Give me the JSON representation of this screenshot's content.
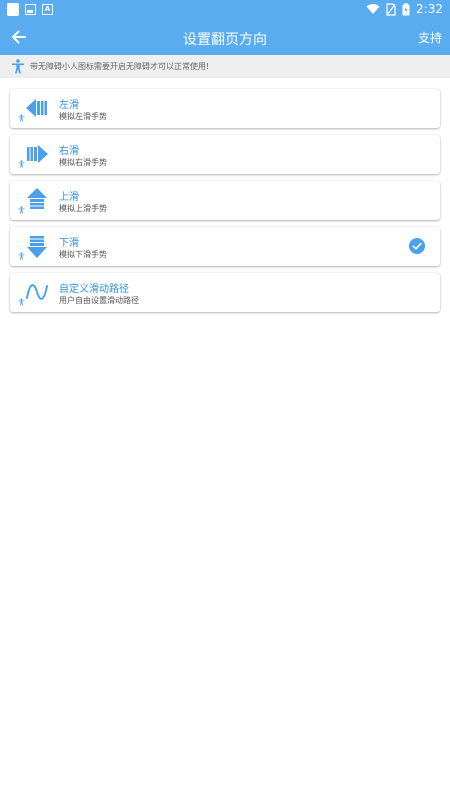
{
  "status_bar": {
    "time": "2:32"
  },
  "app_bar": {
    "title": "设置翻页方向",
    "support_label": "支持"
  },
  "notice": {
    "text": "带无障碍小人图标需要开启无障碍才可以正常使用!"
  },
  "options": [
    {
      "title": "左滑",
      "subtitle": "模拟左滑手势",
      "icon": "arrow-left-icon",
      "selected": false
    },
    {
      "title": "右滑",
      "subtitle": "模拟右滑手势",
      "icon": "arrow-right-icon",
      "selected": false
    },
    {
      "title": "上滑",
      "subtitle": "模拟上滑手势",
      "icon": "arrow-up-icon",
      "selected": false
    },
    {
      "title": "下滑",
      "subtitle": "模拟下滑手势",
      "icon": "arrow-down-icon",
      "selected": true
    },
    {
      "title": "自定义滑动路径",
      "subtitle": "用户自由设置滑动路径",
      "icon": "wave-path-icon",
      "selected": false
    }
  ],
  "colors": {
    "primary": "#5aacf0",
    "icon_blue": "#4aa0ea",
    "title_blue": "#2f8fe0",
    "notice_bg": "#efefef"
  }
}
